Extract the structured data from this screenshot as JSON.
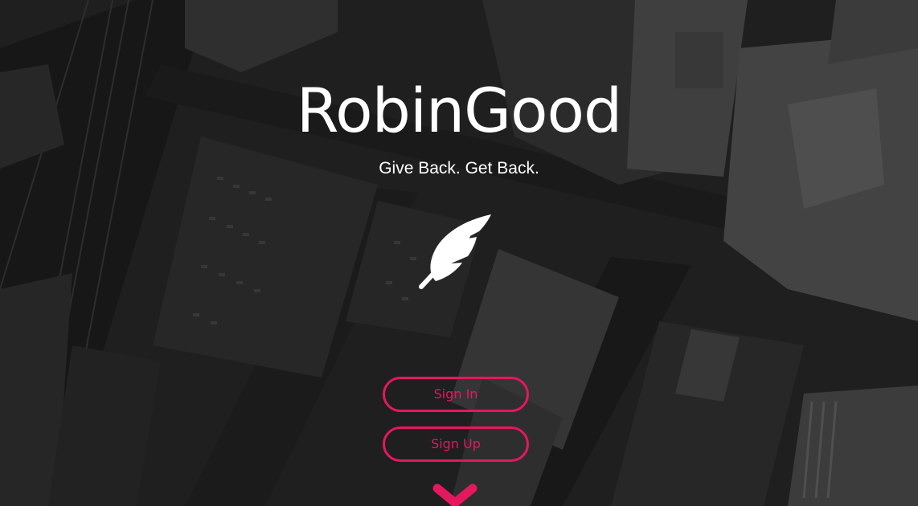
{
  "brand": {
    "title": "RobinGood",
    "tagline": "Give Back. Get Back."
  },
  "actions": {
    "sign_in_label": "Sign In",
    "sign_up_label": "Sign Up"
  },
  "icons": {
    "logo": "feather-icon",
    "scroll": "chevron-down-icon"
  },
  "colors": {
    "accent": "#e5175f",
    "text": "#ffffff",
    "overlay": "#1c1c1c"
  }
}
